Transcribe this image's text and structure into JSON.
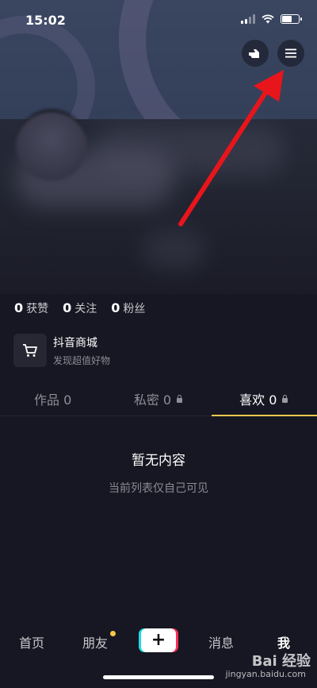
{
  "status_bar": {
    "time": "15:02"
  },
  "stats": [
    {
      "count": "0",
      "label": "获赞"
    },
    {
      "count": "0",
      "label": "关注"
    },
    {
      "count": "0",
      "label": "粉丝"
    }
  ],
  "shop": {
    "title": "抖音商城",
    "subtitle": "发现超值好物"
  },
  "tabs": [
    {
      "label": "作品 0",
      "locked": false,
      "active": false
    },
    {
      "label": "私密 0",
      "locked": true,
      "active": false
    },
    {
      "label": "喜欢 0",
      "locked": true,
      "active": true
    }
  ],
  "empty_state": {
    "title": "暂无内容",
    "subtitle": "当前列表仅自己可见"
  },
  "bottom_nav": {
    "home": "首页",
    "friends": "朋友",
    "create": "+",
    "messages": "消息",
    "me": "我"
  },
  "watermark": {
    "brand": "Bai 经验",
    "url": "jingyan.baidu.com"
  },
  "colors": {
    "accent": "#f2c84b",
    "arrow": "#e8151b",
    "background": "#161722"
  }
}
